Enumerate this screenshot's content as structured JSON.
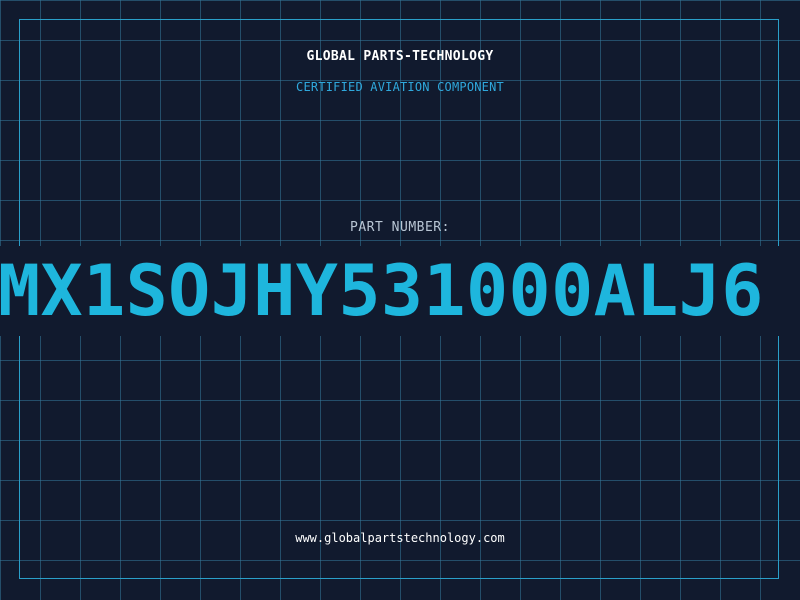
{
  "header": {
    "company": "GLOBAL PARTS-TECHNOLOGY",
    "tagline": "CERTIFIED AVIATION COMPONENT"
  },
  "part": {
    "label": "PART NUMBER:",
    "number": "MX1SOJHY531000ALJ6"
  },
  "footer": {
    "url": "www.globalpartstechnology.com"
  },
  "colors": {
    "background": "#111a2e",
    "grid": "#34789b",
    "frame": "#2a9fc9",
    "accent": "#1eb6dd",
    "label": "#b9c6d4",
    "text": "#ffffff"
  }
}
